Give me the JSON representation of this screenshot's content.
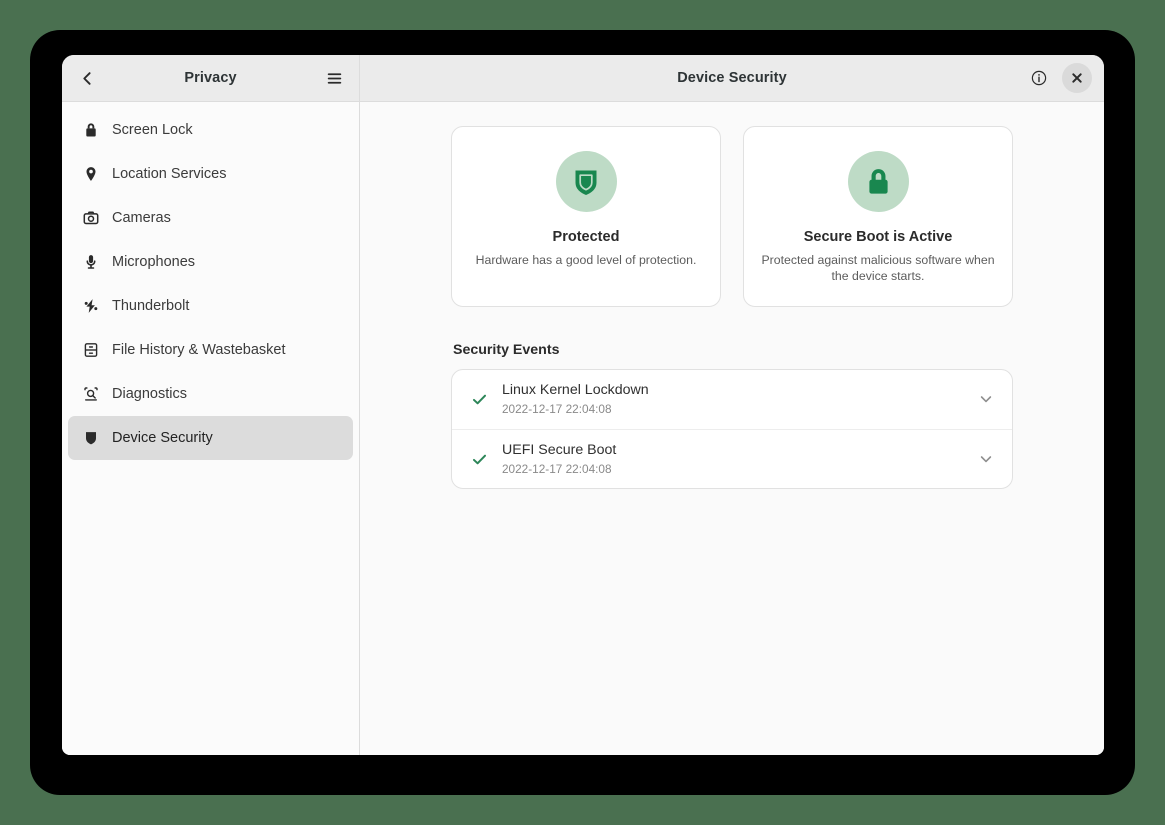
{
  "window": {
    "sidebar_header": {
      "back_label": "Back",
      "title": "Privacy",
      "menu_label": "Main Menu"
    },
    "content_header": {
      "title": "Device Security",
      "info_label": "About Device Security",
      "close_label": "Close"
    }
  },
  "sidebar": {
    "items": [
      {
        "label": "Screen Lock",
        "icon": "lock-icon",
        "selected": false
      },
      {
        "label": "Location Services",
        "icon": "location-pin-icon",
        "selected": false
      },
      {
        "label": "Cameras",
        "icon": "camera-icon",
        "selected": false
      },
      {
        "label": "Microphones",
        "icon": "microphone-icon",
        "selected": false
      },
      {
        "label": "Thunderbolt",
        "icon": "bolt-icon",
        "selected": false
      },
      {
        "label": "File History & Wastebasket",
        "icon": "drawers-icon",
        "selected": false
      },
      {
        "label": "Diagnostics",
        "icon": "magnifier-icon",
        "selected": false
      },
      {
        "label": "Device Security",
        "icon": "shield-icon",
        "selected": true
      }
    ]
  },
  "main": {
    "status_cards": [
      {
        "icon": "shield-check-icon",
        "title": "Protected",
        "description": "Hardware has a good level of protection."
      },
      {
        "icon": "padlock-icon",
        "title": "Secure Boot is Active",
        "description": "Protected against malicious software when the device starts."
      }
    ],
    "events_section": {
      "heading": "Security Events",
      "rows": [
        {
          "status_icon": "check-icon",
          "title": "Linux Kernel Lockdown",
          "timestamp": "2022-12-17 22:04:08",
          "expander_icon": "chevron-down-icon"
        },
        {
          "status_icon": "check-icon",
          "title": "UEFI Secure Boot",
          "timestamp": "2022-12-17 22:04:08",
          "expander_icon": "chevron-down-icon"
        }
      ]
    }
  },
  "colors": {
    "backdrop": "#4a7050",
    "frame": "#000000",
    "accent_green": "#19874f",
    "accent_green_soft": "#bedbc6",
    "check_green": "#2d8659",
    "headerbar": "#ebebeb",
    "content_bg": "#fafafa",
    "card_bg": "#ffffff",
    "selected_row": "#dcdcdc"
  }
}
